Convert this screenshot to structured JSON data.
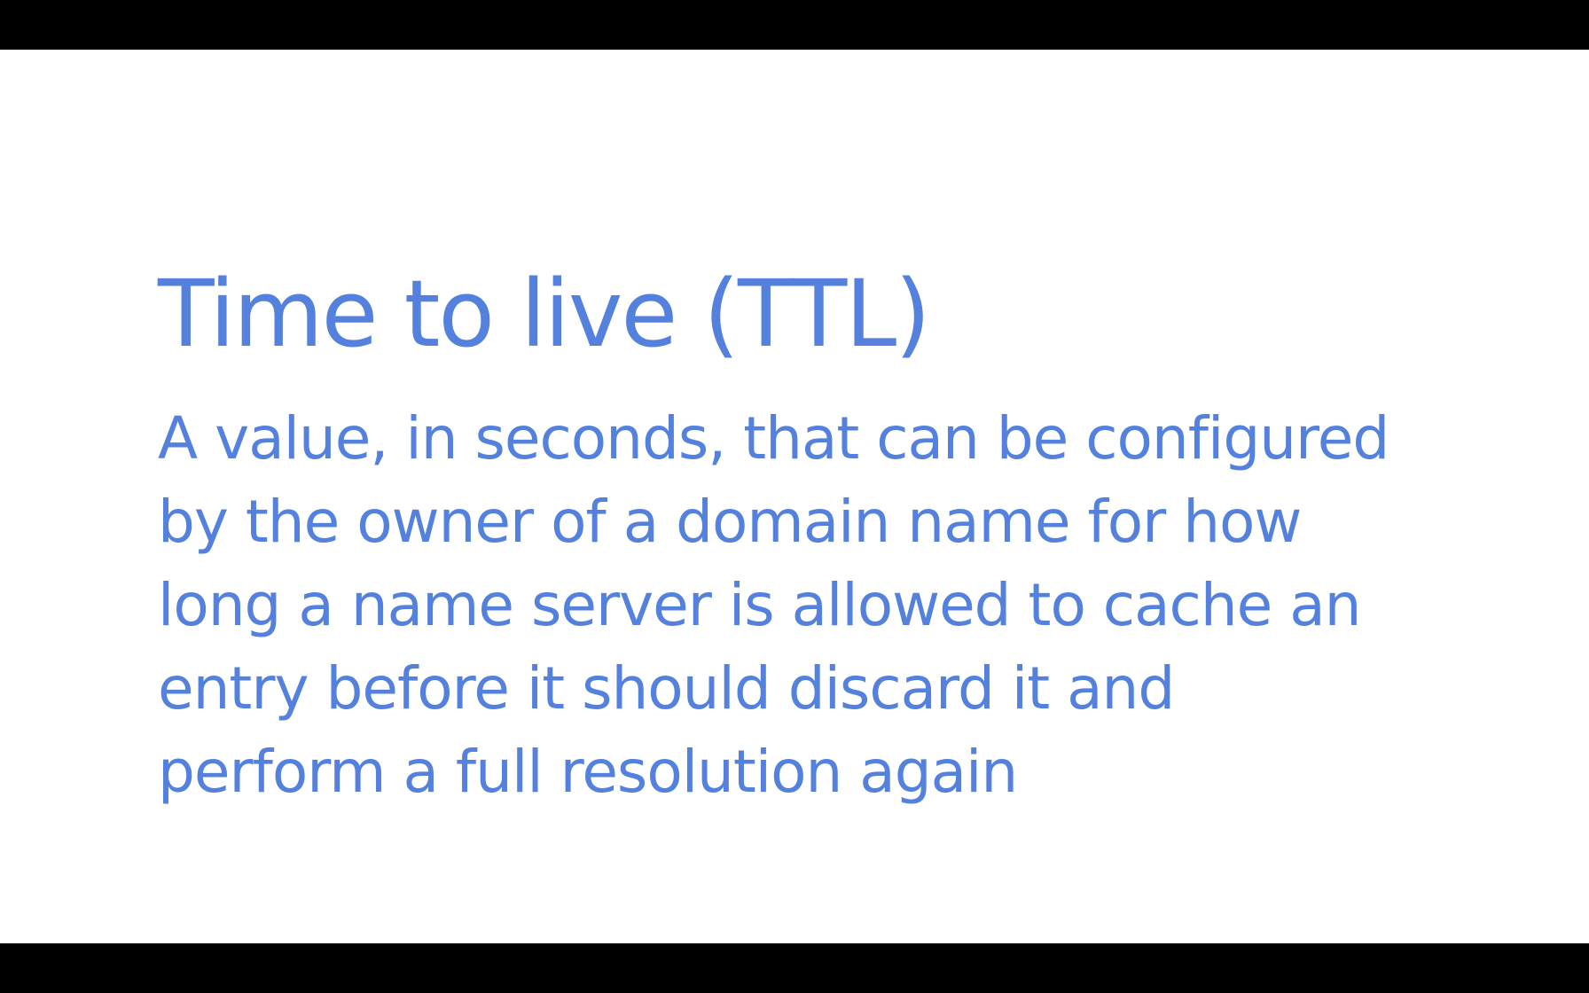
{
  "colors": {
    "accent": "#5381DD",
    "slide_background": "#FFFFFF",
    "letterbox": "#000000"
  },
  "slide": {
    "title": "Time to live (TTL)",
    "definition_lines": [
      "A value, in seconds, that can be configured",
      "by the owner of a domain name for how",
      "long a name server is allowed to cache an",
      "entry before it should discard it and",
      "perform a full resolution again"
    ]
  }
}
